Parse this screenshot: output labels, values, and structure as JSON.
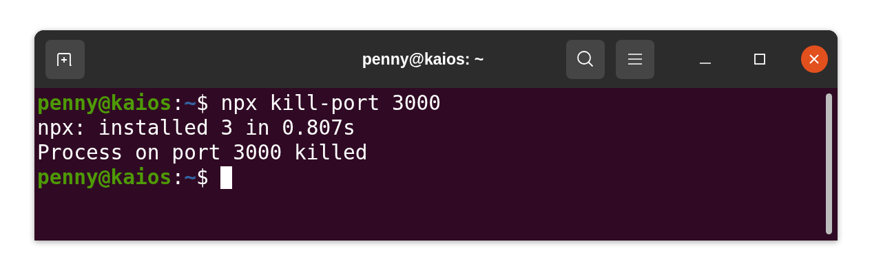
{
  "window": {
    "title": "penny@kaios: ~"
  },
  "terminal": {
    "lines": [
      {
        "segments": [
          {
            "kind": "host",
            "text": "penny@kaios"
          },
          {
            "kind": "plain",
            "text": ":"
          },
          {
            "kind": "path",
            "text": "~"
          },
          {
            "kind": "plain",
            "text": "$ npx kill-port 3000"
          }
        ],
        "cursor": false
      },
      {
        "segments": [
          {
            "kind": "plain",
            "text": "npx: installed 3 in 0.807s"
          }
        ],
        "cursor": false
      },
      {
        "segments": [
          {
            "kind": "plain",
            "text": "Process on port 3000 killed"
          }
        ],
        "cursor": false
      },
      {
        "segments": [
          {
            "kind": "host",
            "text": "penny@kaios"
          },
          {
            "kind": "plain",
            "text": ":"
          },
          {
            "kind": "path",
            "text": "~"
          },
          {
            "kind": "plain",
            "text": "$ "
          }
        ],
        "cursor": true
      }
    ]
  }
}
